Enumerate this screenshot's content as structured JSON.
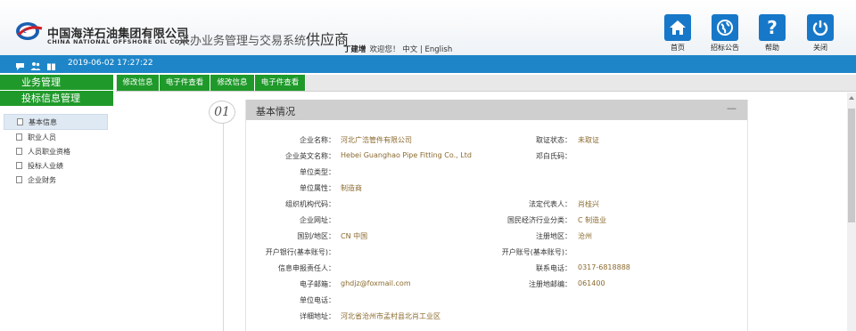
{
  "header": {
    "company_cn": "中国海洋石油集团有限公司",
    "company_en": "CHINA NATIONAL OFFSHORE OIL CORP",
    "system_title": "采办业务管理与交易系统",
    "system_role": "供应商",
    "user_name": "丁建增",
    "welcome": "欢迎您！",
    "lang_cn": "中文",
    "lang_sep": "|",
    "lang_en": "English",
    "buttons": [
      {
        "label": "首页",
        "icon": "home-icon"
      },
      {
        "label": "招标公告",
        "icon": "globe-icon"
      },
      {
        "label": "帮助",
        "icon": "help-icon"
      },
      {
        "label": "关闭",
        "icon": "power-icon"
      }
    ],
    "accent_color": "#1778c9"
  },
  "infobar": {
    "datetime": "2019-06-02 17:27:22",
    "icons": [
      "chat-icon",
      "users-icon",
      "gift-icon"
    ],
    "color": "#1e86c8"
  },
  "sidebar": {
    "sections": [
      "业务管理",
      "投标信息管理"
    ],
    "items": [
      {
        "label": "基本信息",
        "active": true
      },
      {
        "label": "职业人员",
        "active": false
      },
      {
        "label": "人员职业资格",
        "active": false
      },
      {
        "label": "投标人业绩",
        "active": false
      },
      {
        "label": "企业财务",
        "active": false
      }
    ],
    "accent_color": "#1f9a2a"
  },
  "tabs": [
    "修改信息",
    "电子件查看",
    "修改信息",
    "电子件查看"
  ],
  "section": {
    "number": "01",
    "title": "基本情况",
    "collapse": "—"
  },
  "fields": [
    {
      "left_label": "企业名称：",
      "left_value": "河北广浩管件有限公司",
      "right_label": "取证状态：",
      "right_value": "未取证"
    },
    {
      "left_label": "企业英文名称：",
      "left_value": "Hebei Guanghao Pipe Fitting Co., Ltd",
      "right_label": "邓白氏码：",
      "right_value": ""
    },
    {
      "left_label": "单位类型：",
      "left_value": "",
      "right_label": "",
      "right_value": ""
    },
    {
      "left_label": "单位属性：",
      "left_value": "制造商",
      "right_label": "",
      "right_value": ""
    },
    {
      "left_label": "组织机构代码：",
      "left_value": "",
      "right_label": "法定代表人：",
      "right_value": "肖桂兴"
    },
    {
      "left_label": "企业网址：",
      "left_value": "",
      "right_label": "国民经济行业分类：",
      "right_value": "C 制造业"
    },
    {
      "left_label": "国别/地区：",
      "left_value": "CN 中国",
      "right_label": "注册地区：",
      "right_value": "沧州"
    },
    {
      "left_label": "开户银行(基本账号)：",
      "left_value": "",
      "right_label": "开户账号(基本账号)：",
      "right_value": ""
    },
    {
      "left_label": "信息申报责任人：",
      "left_value": "",
      "right_label": "联系电话：",
      "right_value": "0317-6818888"
    },
    {
      "left_label": "电子邮箱：",
      "left_value": "ghdjz@foxmail.com",
      "right_label": "注册地邮编：",
      "right_value": "061400"
    },
    {
      "left_label": "单位电话：",
      "left_value": "",
      "right_label": "",
      "right_value": ""
    },
    {
      "left_label": "详细地址：",
      "left_value": "河北省沧州市孟村县北肖工业区",
      "right_label": "",
      "right_value": ""
    }
  ]
}
